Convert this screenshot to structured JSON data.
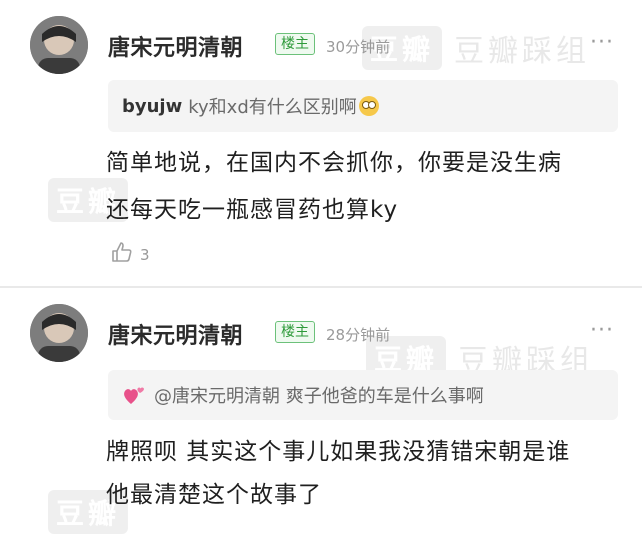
{
  "watermark": {
    "box_text": "豆瓣",
    "text": "豆瓣踩组"
  },
  "comments": [
    {
      "username": "唐宋元明清朝",
      "badge": "楼主",
      "time": "30分钟前",
      "more": "···",
      "quote": {
        "user": "byujw",
        "text": "ky和xd有什么区别啊"
      },
      "lines": [
        "简单地说，在国内不会抓你，你要是没生病",
        "还每天吃一瓶感冒药也算ky"
      ],
      "likes": "3",
      "icons": {
        "like": "thumbs-up-icon",
        "quote_emoji": "flushed-face-icon"
      }
    },
    {
      "username": "唐宋元明清朝",
      "badge": "楼主",
      "time": "28分钟前",
      "more": "···",
      "quote": {
        "text": "@唐宋元明清朝 爽子他爸的车是什么事啊"
      },
      "lines": [
        "牌照呗 其实这个事儿如果我没猜错宋朝是谁",
        "他最清楚这个故事了"
      ],
      "icons": {
        "quote_emoji": "two-hearts-icon"
      }
    }
  ],
  "colors": {
    "badge_green": "#2e9a3a",
    "muted": "#9a9a9a",
    "quote_bg": "#f4f4f4"
  }
}
